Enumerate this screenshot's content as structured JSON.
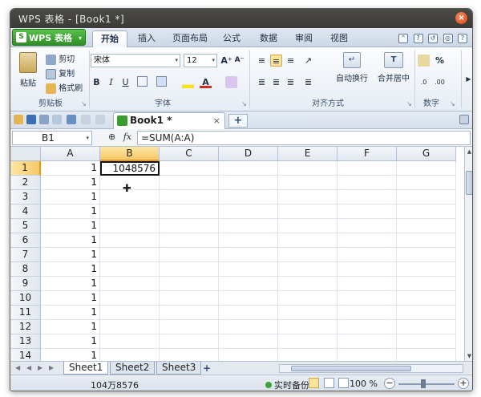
{
  "window": {
    "title": "WPS 表格 - [Book1 *]",
    "close_glyph": "×"
  },
  "app_button": {
    "label": "WPS 表格",
    "logo": "S",
    "caret": "▾"
  },
  "tabs": [
    "开始",
    "插入",
    "页面布局",
    "公式",
    "数据",
    "审阅",
    "视图"
  ],
  "tab_icon_glyphs": [
    "⌃",
    "?",
    "↺",
    "◎",
    "?"
  ],
  "ribbon": {
    "clipboard": {
      "paste": "粘贴",
      "cut": "剪切",
      "copy": "复制",
      "format_painter": "格式刷",
      "group": "剪贴板"
    },
    "font": {
      "name": "宋体",
      "size": "12",
      "grow": "A⁺",
      "shrink": "A⁻",
      "bold": "B",
      "italic": "I",
      "underline": "U",
      "group": "字体",
      "font_color_glyph": "A"
    },
    "alignment": {
      "wrap": "自动换行",
      "merge": "合并居中",
      "group": "对齐方式"
    },
    "number": {
      "percent": "%",
      "group": "数字"
    },
    "dropdown_glyph": "▾",
    "dialog_launcher_glyph": "↘"
  },
  "quickbar": {
    "doc_tab": "Book1 *",
    "close_glyph": "×",
    "new_tab": "+"
  },
  "formula_bar": {
    "cell_ref": "B1",
    "fx": "fx",
    "zoom_glyph": "⊕",
    "formula": "=SUM(A:A)"
  },
  "columns": [
    "A",
    "B",
    "C",
    "D",
    "E",
    "F",
    "G"
  ],
  "rows": [
    {
      "n": "1",
      "a": "1",
      "b": "1048576"
    },
    {
      "n": "2",
      "a": "1",
      "b": ""
    },
    {
      "n": "3",
      "a": "1",
      "b": ""
    },
    {
      "n": "4",
      "a": "1",
      "b": ""
    },
    {
      "n": "5",
      "a": "1",
      "b": ""
    },
    {
      "n": "6",
      "a": "1",
      "b": ""
    },
    {
      "n": "7",
      "a": "1",
      "b": ""
    },
    {
      "n": "8",
      "a": "1",
      "b": ""
    },
    {
      "n": "9",
      "a": "1",
      "b": ""
    },
    {
      "n": "10",
      "a": "1",
      "b": ""
    },
    {
      "n": "11",
      "a": "1",
      "b": ""
    },
    {
      "n": "12",
      "a": "1",
      "b": ""
    },
    {
      "n": "13",
      "a": "1",
      "b": ""
    },
    {
      "n": "14",
      "a": "1",
      "b": ""
    }
  ],
  "sheets": [
    "Sheet1",
    "Sheet2",
    "Sheet3"
  ],
  "add_sheet": "+",
  "sheet_nav_glyphs": [
    "◀",
    "◀",
    "▶",
    "▶"
  ],
  "status": {
    "sum_text": "104万8576",
    "backup": "实时备份",
    "zoom": "100 %",
    "zoom_minus": "−",
    "zoom_plus": "+"
  },
  "colors": {
    "accent_green": "#2f8f26",
    "selection_orange": "#f7c867"
  }
}
